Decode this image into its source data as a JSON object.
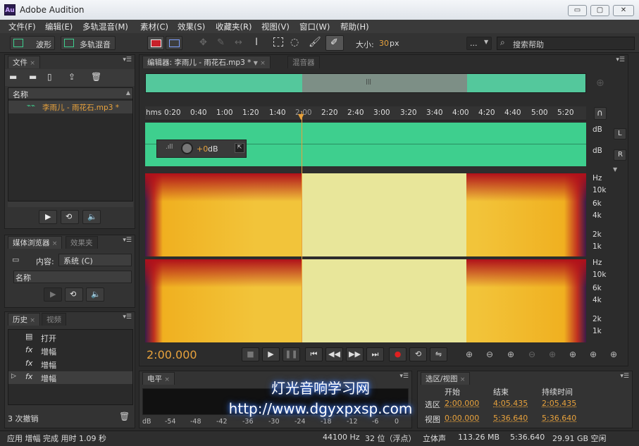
{
  "app": {
    "title": "Adobe Audition",
    "logo": "Au"
  },
  "window_controls": {
    "minimize": "▭",
    "restore": "▢",
    "close": "✕"
  },
  "menubar": [
    "文件(F)",
    "编辑(E)",
    "多轨混音(M)",
    "素材(C)",
    "效果(S)",
    "收藏夹(R)",
    "视图(V)",
    "窗口(W)",
    "帮助(H)"
  ],
  "toolbar": {
    "waveform_label": "波形",
    "multitrack_label": "多轨混音",
    "size_label": "大小:",
    "size_value": "30",
    "size_unit": "px",
    "workspace_value": "...",
    "search_placeholder": "搜索帮助"
  },
  "files_panel": {
    "tab": "文件",
    "column_name": "名称",
    "file": "李雨儿 - 雨花石.mp3 *"
  },
  "media_panel": {
    "tab": "媒体浏览器",
    "tab2": "效果夹",
    "content_label": "内容:",
    "content_value": "系统 (C)",
    "column_name": "名称"
  },
  "history_panel": {
    "tab": "历史",
    "tab2": "视频",
    "items": [
      {
        "icon": "open-icon",
        "label": "打开"
      },
      {
        "icon": "fx-icon",
        "label": "增幅"
      },
      {
        "icon": "fx-icon",
        "label": "增幅"
      },
      {
        "icon": "fx-icon",
        "label": "增幅"
      }
    ],
    "undo_count": "3 次撤销"
  },
  "editor": {
    "tab": "编辑器: 李雨儿 - 雨花石.mp3 *",
    "tab2": "混音器",
    "timeline_labels": [
      "hms",
      "0:20",
      "0:40",
      "1:00",
      "1:20",
      "1:40",
      "2:00",
      "2:20",
      "2:40",
      "3:00",
      "3:20",
      "3:40",
      "4:00",
      "4:20",
      "4:40",
      "5:00",
      "5:20"
    ],
    "gain_value": "+0",
    "gain_unit": "dB",
    "db_label": "dB",
    "channel_l": "L",
    "channel_r": "R",
    "hz_labels": [
      "Hz",
      "10k",
      "6k",
      "4k",
      "2k",
      "1k"
    ],
    "current_time": "2:00.000"
  },
  "level_panel": {
    "tab": "电平",
    "scale": [
      "dB",
      "-54",
      "-48",
      "-42",
      "-36",
      "-30",
      "-24",
      "-18",
      "-12",
      "-6",
      "0"
    ]
  },
  "selection_panel": {
    "tab": "选区/视图",
    "headers": [
      "开始",
      "结束",
      "持续时间"
    ],
    "rows": [
      {
        "label": "选区",
        "start": "2:00.000",
        "end": "4:05.435",
        "duration": "2:05.435"
      },
      {
        "label": "视图",
        "start": "0:00.000",
        "end": "5:36.640",
        "duration": "5:36.640"
      }
    ]
  },
  "statusbar": {
    "message": "应用 增幅 完成 用时 1.09 秒",
    "sample_rate": "44100 Hz",
    "bit_depth": "32 位（浮点）",
    "channels": "立体声",
    "size": "113.26 MB",
    "duration": "5:36.640",
    "free_space": "29.91 GB 空闲"
  },
  "watermark": {
    "line1": "灯光音响学习网",
    "line2": "http://www.dgyxpxsp.com"
  },
  "colors": {
    "accent": "#e8a23c",
    "wave": "#3ecf8e",
    "selection": "#e8e69a"
  }
}
